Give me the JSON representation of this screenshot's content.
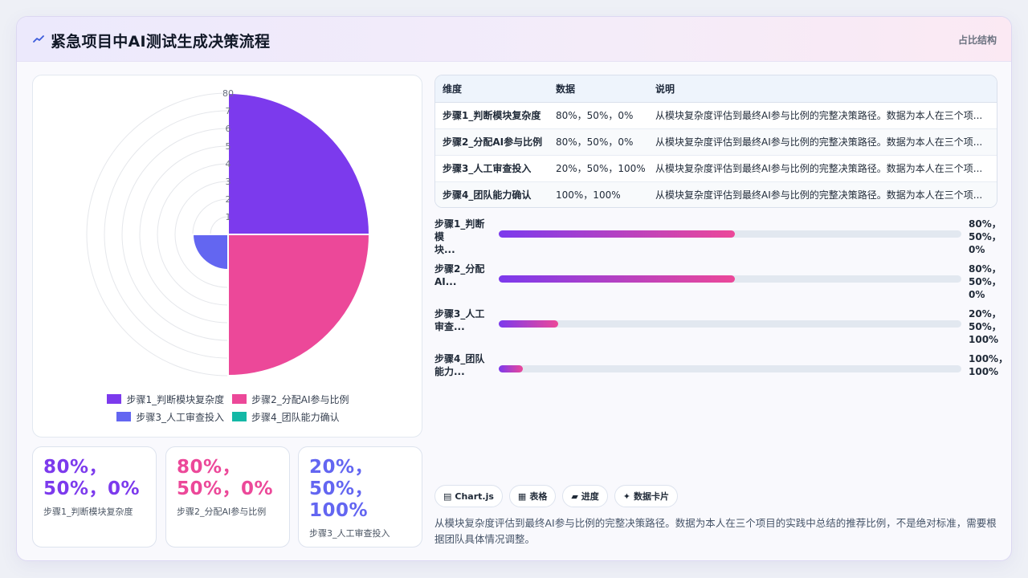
{
  "header": {
    "title": "紧急项目中AI测试生成决策流程",
    "right_label": "占比结构"
  },
  "colors": {
    "step1": "#7c3aed",
    "step2": "#ec4899",
    "step3": "#6366f1",
    "step4": "#14b8a6"
  },
  "chart_data": {
    "type": "polarArea",
    "title": "",
    "categories": [
      "步骤1_判断模块复杂度",
      "步骤2_分配AI参与比例",
      "步骤3_人工审查投入",
      "步骤4_团队能力确认"
    ],
    "values": [
      80,
      80,
      20,
      0
    ],
    "r_ticks": [
      1,
      2,
      3,
      4,
      5,
      6,
      7,
      80
    ],
    "r_tick_labels": [
      "1",
      "2",
      "3",
      "4",
      "5",
      "6",
      "7",
      "80"
    ],
    "r_max": 80,
    "grid": true,
    "legend_position": "bottom"
  },
  "kpis": [
    {
      "value": "80%，50%，0%",
      "label": "步骤1_判断模块复杂度",
      "color": "#7c3aed"
    },
    {
      "value": "80%，50%，0%",
      "label": "步骤2_分配AI参与比例",
      "color": "#ec4899"
    },
    {
      "value": "20%，50%，100%",
      "label": "步骤3_人工审查投入",
      "color": "#6366f1"
    }
  ],
  "table": {
    "columns": [
      "维度",
      "数据",
      "说明"
    ],
    "rows": [
      [
        "步骤1_判断模块复杂度",
        "80%，50%，0%",
        "从模块复杂度评估到最终AI参与比例的完整决策路径。数据为本人在三个项..."
      ],
      [
        "步骤2_分配AI参与比例",
        "80%，50%，0%",
        "从模块复杂度评估到最终AI参与比例的完整决策路径。数据为本人在三个项..."
      ],
      [
        "步骤3_人工审查投入",
        "20%，50%，100%",
        "从模块复杂度评估到最终AI参与比例的完整决策路径。数据为本人在三个项..."
      ],
      [
        "步骤4_团队能力确认",
        "100%，100%",
        "从模块复杂度评估到最终AI参与比例的完整决策路径。数据为本人在三个项..."
      ]
    ]
  },
  "progress": [
    {
      "label": "步骤1_判断模块块...",
      "label_display": "步骤1_判断模\n块...",
      "value_text": "80%，\n50%，\n0%",
      "fraction": 0.51
    },
    {
      "label_display": "步骤2_分配\nAI...",
      "value_text": "80%，\n50%，\n0%",
      "fraction": 0.51
    },
    {
      "label_display": "步骤3_人工\n审查...",
      "value_text": "20%，\n50%，\n100%",
      "fraction": 0.128
    },
    {
      "label_display": "步骤4_团队\n能力...",
      "value_text": "100%，\n100%",
      "fraction": 0.052
    }
  ],
  "tags": [
    {
      "icon": "▤",
      "icon_name": "chart-icon",
      "label": "Chart.js"
    },
    {
      "icon": "▦",
      "icon_name": "table-icon",
      "label": "表格"
    },
    {
      "icon": "▰",
      "icon_name": "progress-icon",
      "label": "进度"
    },
    {
      "icon": "✦",
      "icon_name": "card-icon",
      "label": "数据卡片"
    }
  ],
  "note": "从模块复杂度评估到最终AI参与比例的完整决策路径。数据为本人在三个项目的实践中总结的推荐比例，不是绝对标准，需要根据团队具体情况调整。"
}
